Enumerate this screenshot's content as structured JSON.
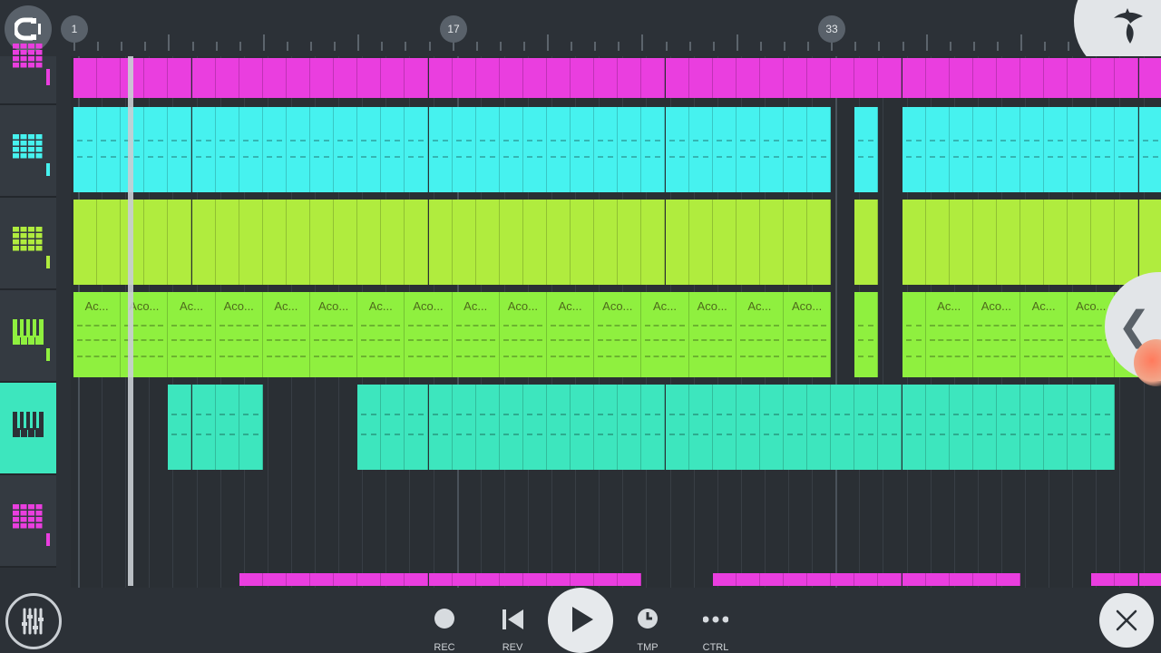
{
  "ruler": {
    "markers": [
      "1",
      "17",
      "33"
    ]
  },
  "tracks": [
    {
      "icon": "pattern-icon",
      "color": "#ea3edf",
      "selected": false
    },
    {
      "icon": "pattern-icon",
      "color": "#46f2ef",
      "selected": false
    },
    {
      "icon": "pattern-icon",
      "color": "#b0ec3e",
      "selected": false
    },
    {
      "icon": "piano-icon",
      "color": "#8ff03f",
      "selected": false
    },
    {
      "icon": "piano-icon",
      "color": "#3de6be",
      "selected": true
    },
    {
      "icon": "pattern-icon",
      "color": "#ea3edf",
      "selected": false
    }
  ],
  "clips": {
    "lane4_label": "Ac...",
    "lane4_label_alt": "Aco..."
  },
  "transport": {
    "rec_label": "REC",
    "rev_label": "REV",
    "tmp_label": "TMP",
    "ctrl_label": "CTRL"
  },
  "colors": {
    "magenta": "#ea3edf",
    "cyan": "#46f2ef",
    "lime": "#b0ec3e",
    "green": "#8ff03f",
    "teal": "#3de6be",
    "background": "#2c3137"
  }
}
